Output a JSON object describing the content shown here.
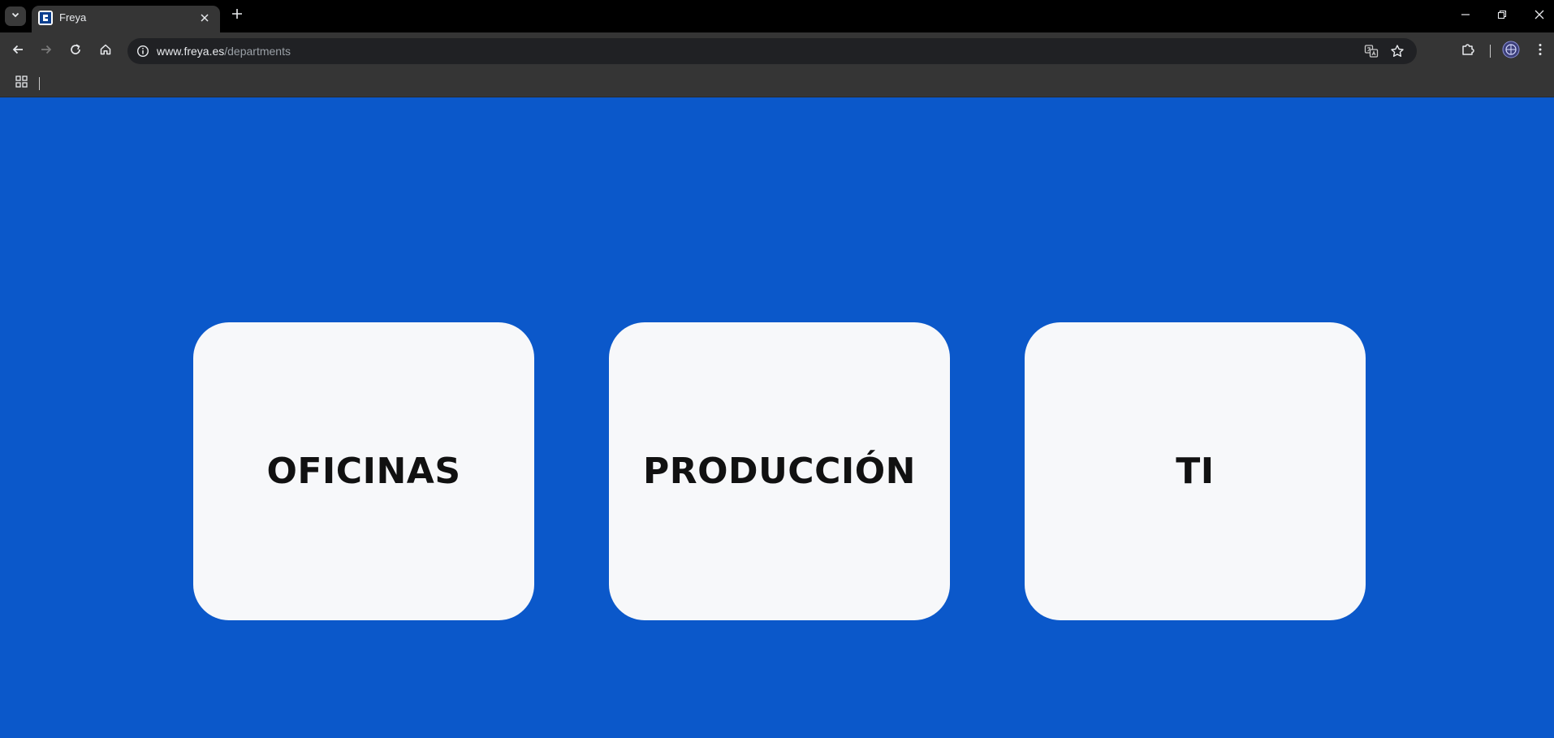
{
  "browser": {
    "tab": {
      "title": "Freya"
    },
    "address_bar": {
      "host": "www.freya.es",
      "path": "/departments"
    }
  },
  "departments": [
    {
      "label": "OFICINAS"
    },
    {
      "label": "PRODUCCIÓN"
    },
    {
      "label": "TI"
    }
  ],
  "colors": {
    "page_background": "#0b58ca",
    "card_background": "#f7f8fa",
    "card_text": "#111111",
    "chrome_dark": "#353535"
  }
}
